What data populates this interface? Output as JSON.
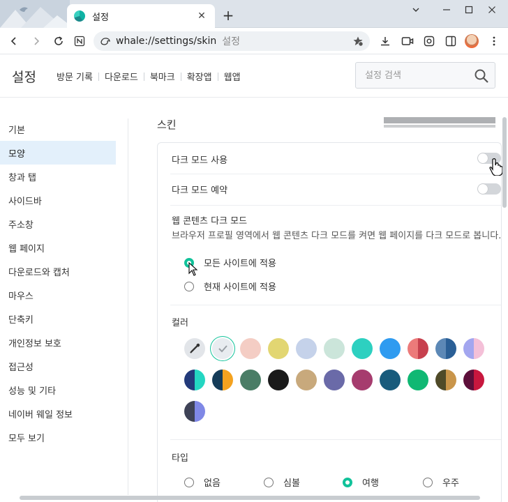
{
  "browser": {
    "tab_title": "설정",
    "url": "whale://settings/skin",
    "url_suffix": "설정"
  },
  "header": {
    "title": "설정",
    "nav": [
      "방문 기록",
      "다운로드",
      "북마크",
      "확장앱",
      "웹앱"
    ],
    "search_placeholder": "설정 검색"
  },
  "sidebar": {
    "items": [
      "기본",
      "모양",
      "창과 탭",
      "사이드바",
      "주소창",
      "웹 페이지",
      "다운로드와 캡처",
      "마우스",
      "단축키",
      "개인정보 보호",
      "접근성",
      "성능 및 기타",
      "네이버 웨일 정보",
      "모두 보기"
    ],
    "active": "모양"
  },
  "main": {
    "section_title": "스킨",
    "dark_mode": {
      "label": "다크 모드 사용",
      "on": false
    },
    "dark_schedule": {
      "label": "다크 모드 예약",
      "on": false
    },
    "web_dark": {
      "title": "웹 콘텐츠 다크 모드",
      "desc": "브라우저 프로필 영역에서 웹 콘텐츠 다크 모드를 켜면 웹 페이지를 다크 모드로 봅니다.",
      "options": [
        "모든 사이트에 적용",
        "현재 사이트에 적용"
      ],
      "selected": "모든 사이트에 적용"
    },
    "color": {
      "label": "컬러",
      "swatches": [
        {
          "icon": "eyedropper-icon",
          "colors": [
            "#e2e5e9"
          ]
        },
        {
          "icon": "check-icon",
          "colors": [
            "#e8ecf0"
          ],
          "selected": true
        },
        {
          "colors": [
            "#f4cdc4"
          ]
        },
        {
          "colors": [
            "#e2d672"
          ]
        },
        {
          "colors": [
            "#c5d2ea"
          ]
        },
        {
          "colors": [
            "#cbe5da"
          ]
        },
        {
          "colors": [
            "#2dd0c0"
          ]
        },
        {
          "colors": [
            "#2f9bf0"
          ]
        },
        {
          "colors": [
            "#ec7a7a",
            "#c7404e"
          ]
        },
        {
          "colors": [
            "#5c88b6",
            "#2a5f96"
          ]
        },
        {
          "colors": [
            "#a3a6ef",
            "#f4c0d8"
          ]
        },
        {
          "colors": [
            "#233a7a",
            "#24d6c2"
          ]
        },
        {
          "colors": [
            "#153c59",
            "#f4a21f"
          ]
        },
        {
          "colors": [
            "#4a7d66"
          ]
        },
        {
          "colors": [
            "#1a1a1a"
          ]
        },
        {
          "colors": [
            "#c8a97c"
          ]
        },
        {
          "colors": [
            "#6a6aa8"
          ]
        },
        {
          "colors": [
            "#a63c6e"
          ]
        },
        {
          "colors": [
            "#185b7c"
          ]
        },
        {
          "colors": [
            "#10b873"
          ]
        },
        {
          "colors": [
            "#4f4a28",
            "#c9954a"
          ]
        },
        {
          "colors": [
            "#5d0f3a",
            "#c8173e"
          ]
        },
        {
          "colors": [
            "#3e4256",
            "#7f88e6"
          ]
        }
      ]
    },
    "type": {
      "label": "타입",
      "options": [
        "없음",
        "심볼",
        "여행",
        "우주"
      ],
      "selected": "여행"
    }
  },
  "colors": {
    "accent": "#11c29a",
    "active_sidebar": "#e3f0fb"
  }
}
